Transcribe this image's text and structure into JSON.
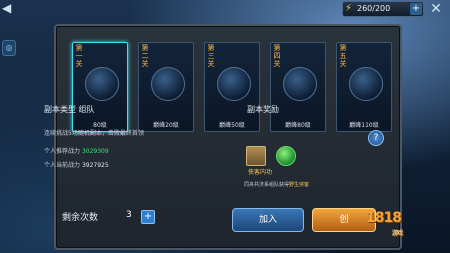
{
  "topbar": {
    "energy": "260/200"
  },
  "stages": [
    {
      "stage": "第一关",
      "level": "80级"
    },
    {
      "stage": "第二关",
      "level": "巅峰20级"
    },
    {
      "stage": "第三关",
      "level": "巅峰50级"
    },
    {
      "stage": "第四关",
      "level": "巅峰80级"
    },
    {
      "stage": "第五关",
      "level": "巅峰110级"
    }
  ],
  "info": {
    "title": "副本类型 组队",
    "desc": "连续挑战5场随机副本，击败最终首领",
    "recommended_label": "个人推荐战力",
    "recommended_value": "3029309",
    "current_label": "个人当前战力",
    "current_value": "3927925"
  },
  "reward": {
    "title": "副本奖励",
    "name": "侠客内功",
    "note_prefix": "同舟共济系组队获得",
    "note_highlight": "野生侠客"
  },
  "remaining": {
    "label": "剩余次数",
    "count": "3"
  },
  "buttons": {
    "join": "加入",
    "create": "创"
  },
  "watermark": {
    "brand": "1818",
    "sub": "游戏"
  }
}
